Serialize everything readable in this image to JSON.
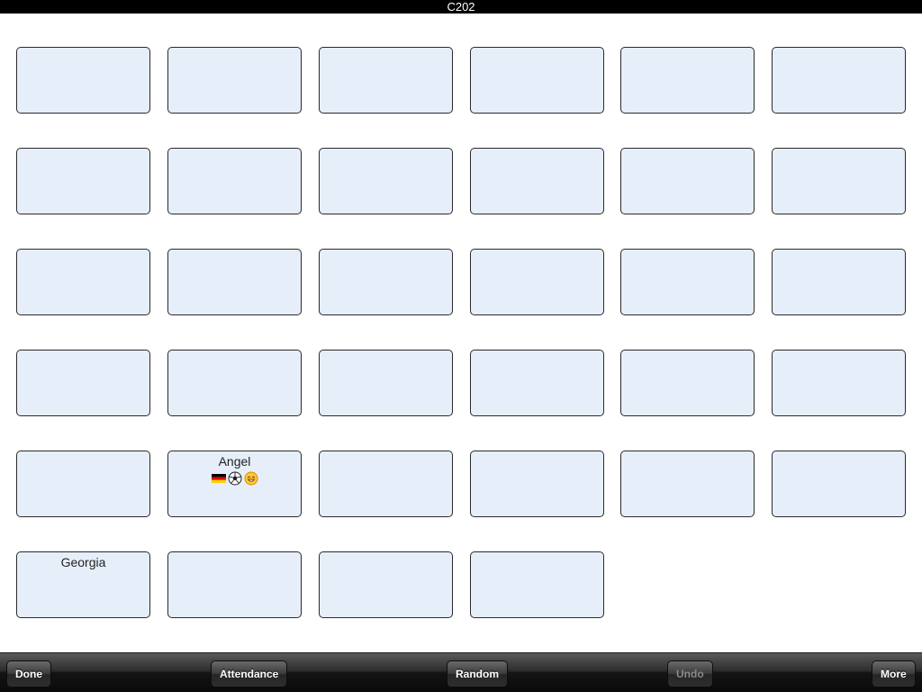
{
  "status_bar": {
    "title": "C202"
  },
  "seats": [
    [
      {
        "name": "",
        "badges": []
      },
      {
        "name": "",
        "badges": []
      },
      {
        "name": "",
        "badges": []
      },
      {
        "name": "",
        "badges": []
      },
      {
        "name": "",
        "badges": []
      },
      {
        "name": "",
        "badges": []
      }
    ],
    [
      {
        "name": "",
        "badges": []
      },
      {
        "name": "",
        "badges": []
      },
      {
        "name": "",
        "badges": []
      },
      {
        "name": "",
        "badges": []
      },
      {
        "name": "",
        "badges": []
      },
      {
        "name": "",
        "badges": []
      }
    ],
    [
      {
        "name": "",
        "badges": []
      },
      {
        "name": "",
        "badges": []
      },
      {
        "name": "",
        "badges": []
      },
      {
        "name": "",
        "badges": []
      },
      {
        "name": "",
        "badges": []
      },
      {
        "name": "",
        "badges": []
      }
    ],
    [
      {
        "name": "",
        "badges": []
      },
      {
        "name": "",
        "badges": []
      },
      {
        "name": "",
        "badges": []
      },
      {
        "name": "",
        "badges": []
      },
      {
        "name": "",
        "badges": []
      },
      {
        "name": "",
        "badges": []
      }
    ],
    [
      {
        "name": "",
        "badges": []
      },
      {
        "name": "Angel",
        "badges": [
          "german-flag-icon",
          "soccer-ball-icon",
          "happy-face-icon"
        ]
      },
      {
        "name": "",
        "badges": []
      },
      {
        "name": "",
        "badges": []
      },
      {
        "name": "",
        "badges": []
      },
      {
        "name": "",
        "badges": []
      }
    ],
    [
      {
        "name": "Georgia",
        "badges": []
      },
      {
        "name": "",
        "badges": []
      },
      {
        "name": "",
        "badges": []
      },
      {
        "name": "",
        "badges": []
      }
    ]
  ],
  "toolbar": {
    "done_label": "Done",
    "attendance_label": "Attendance",
    "random_label": "Random",
    "undo_label": "Undo",
    "more_label": "More"
  },
  "colors": {
    "seat_fill": "#e6eefa",
    "seat_border": "#2a2a2a",
    "toolbar": "#2d2d2d",
    "status_bar": "#000000"
  }
}
